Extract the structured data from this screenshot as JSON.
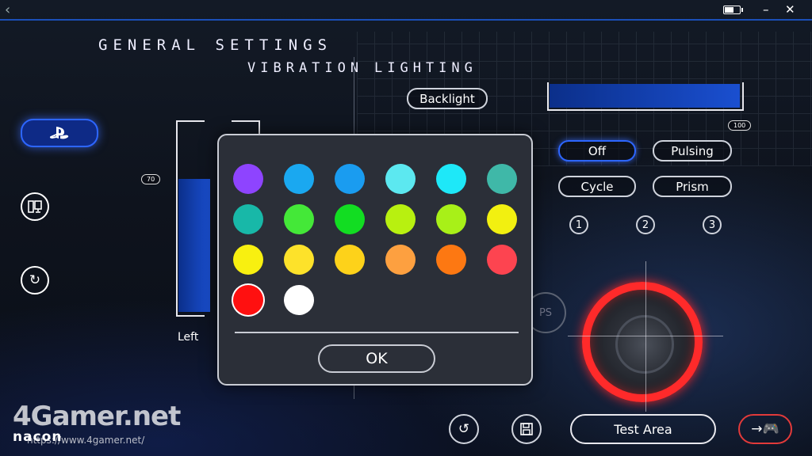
{
  "header": {
    "back_icon": "chevron-left-icon",
    "minimize": "–",
    "close": "✕"
  },
  "sections": {
    "general": "GENERAL SETTINGS",
    "vibration": "VIBRATION",
    "lighting": "LIGHTING"
  },
  "sidebar": {
    "items": [
      {
        "name": "playstation-mode",
        "icon": "ps-icon",
        "active": true
      },
      {
        "name": "pc-mode",
        "icon": "pc-icon"
      },
      {
        "name": "sync",
        "icon": "sync-icon"
      }
    ]
  },
  "vibration": {
    "left_label": "Left",
    "left_value": "70",
    "left_level": 0.7
  },
  "lighting": {
    "backlight_label": "Backlight",
    "brightness_value": "100",
    "brightness_level": 1.0,
    "modes": [
      {
        "label": "Off",
        "active": true
      },
      {
        "label": "Pulsing"
      },
      {
        "label": "Cycle"
      },
      {
        "label": "Prism"
      }
    ],
    "profiles": [
      "1",
      "2",
      "3"
    ]
  },
  "color_picker": {
    "colors": [
      "#8e44ff",
      "#1aa8f0",
      "#1a9cf0",
      "#5ce8f0",
      "#1ee8f8",
      "#3fb8a8",
      "#18b8a8",
      "#44e838",
      "#12dd22",
      "#b8f010",
      "#a8f018",
      "#f2f010",
      "#f8f010",
      "#fde22a",
      "#fdd21a",
      "#fda040",
      "#fd7812",
      "#fd4450",
      "#ff1010",
      "#ffffff"
    ],
    "selected_index": 18,
    "ok_label": "OK"
  },
  "bottom": {
    "reset_icon": "reset-icon",
    "save_icon": "save-icon",
    "test_area_label": "Test Area",
    "next_icon": "arrow-controller-icon"
  },
  "watermark": {
    "site": "4Gamer.net",
    "url": "https://www.4gamer.net/",
    "brand": "nacon"
  }
}
